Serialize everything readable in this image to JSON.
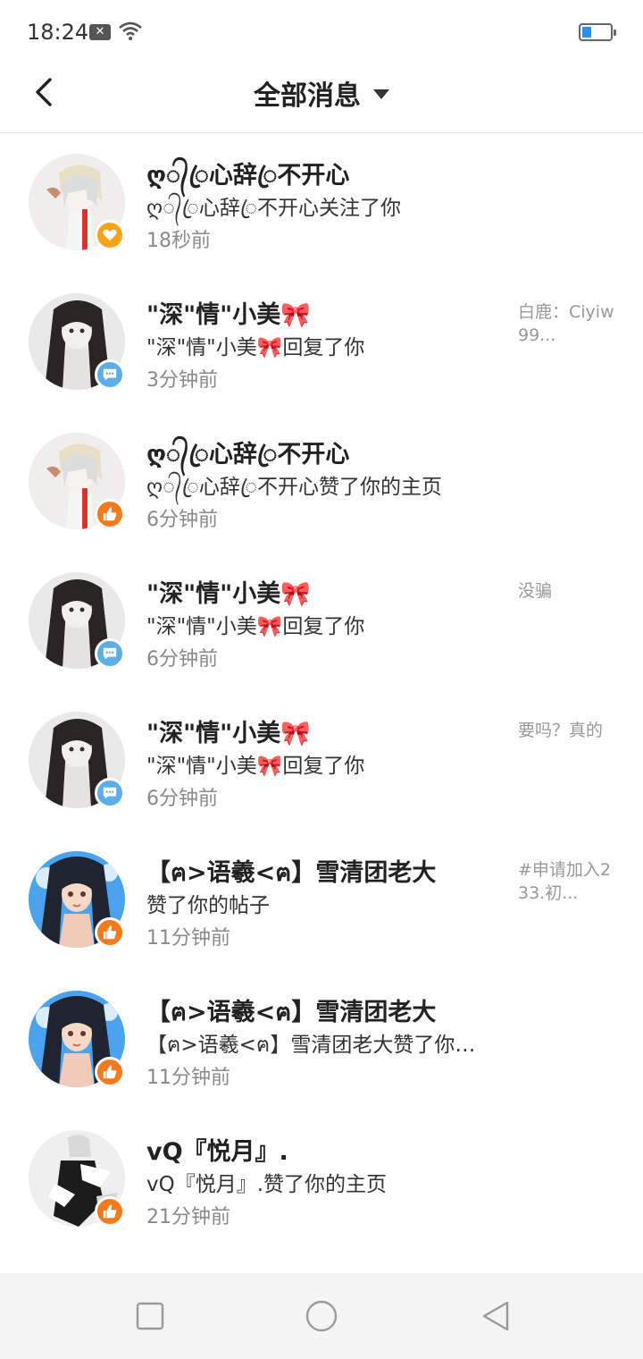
{
  "status_bar": {
    "time": "18:24",
    "notification_icon": "x-box-icon",
    "wifi_icon": "wifi-icon",
    "battery_icon": "battery-icon",
    "battery_level": 0.3
  },
  "header": {
    "title": "全部消息",
    "back_icon": "chevron-left-icon",
    "dropdown_icon": "caret-down-icon"
  },
  "messages": [
    {
      "name": "ღ᭄ꦿ心辞ꦿ不开心",
      "action": "ღ᭄ꦿ心辞ꦿ不开心关注了你",
      "time": "18秒前",
      "snippet": "",
      "badge": "follow",
      "avatar": "girl-white-hair"
    },
    {
      "name": "\"深\"情\"小美🎀",
      "action": "\"深\"情\"小美🎀回复了你",
      "time": "3分钟前",
      "snippet": "白鹿：Ciyiw99...",
      "badge": "reply",
      "avatar": "girl-dark-hair"
    },
    {
      "name": "ღ᭄ꦿ心辞ꦿ不开心",
      "action": "ღ᭄ꦿ心辞ꦿ不开心赞了你的主页",
      "time": "6分钟前",
      "snippet": "",
      "badge": "like",
      "avatar": "girl-white-hair"
    },
    {
      "name": "\"深\"情\"小美🎀",
      "action": "\"深\"情\"小美🎀回复了你",
      "time": "6分钟前",
      "snippet": "没骗",
      "badge": "reply",
      "avatar": "girl-dark-hair"
    },
    {
      "name": "\"深\"情\"小美🎀",
      "action": "\"深\"情\"小美🎀回复了你",
      "time": "6分钟前",
      "snippet": "要吗？真的",
      "badge": "reply",
      "avatar": "girl-dark-hair"
    },
    {
      "name": "【ฅ>语羲<ฅ】雪清团老大",
      "action": "赞了你的帖子",
      "time": "11分钟前",
      "snippet": "#申请加入233.初...",
      "badge": "like",
      "avatar": "girl-blue-bg"
    },
    {
      "name": "【ฅ>语羲<ฅ】雪清团老大",
      "action": "【ฅ>语羲<ฅ】雪清团老大赞了你的...",
      "time": "11分钟前",
      "snippet": "",
      "badge": "like",
      "avatar": "girl-blue-bg"
    },
    {
      "name": "vQ『悦月』.",
      "action": "vQ『悦月』.赞了你的主页",
      "time": "21分钟前",
      "snippet": "",
      "badge": "like",
      "avatar": "figure-black-white"
    }
  ],
  "nav_bar": {
    "recent_icon": "square-icon",
    "home_icon": "circle-icon",
    "back_icon": "triangle-back-icon"
  },
  "colors": {
    "like_badge": "#f37b1d",
    "reply_badge": "#5aafea",
    "follow_badge": "#f7a21b",
    "battery": "#2f8ee8"
  }
}
